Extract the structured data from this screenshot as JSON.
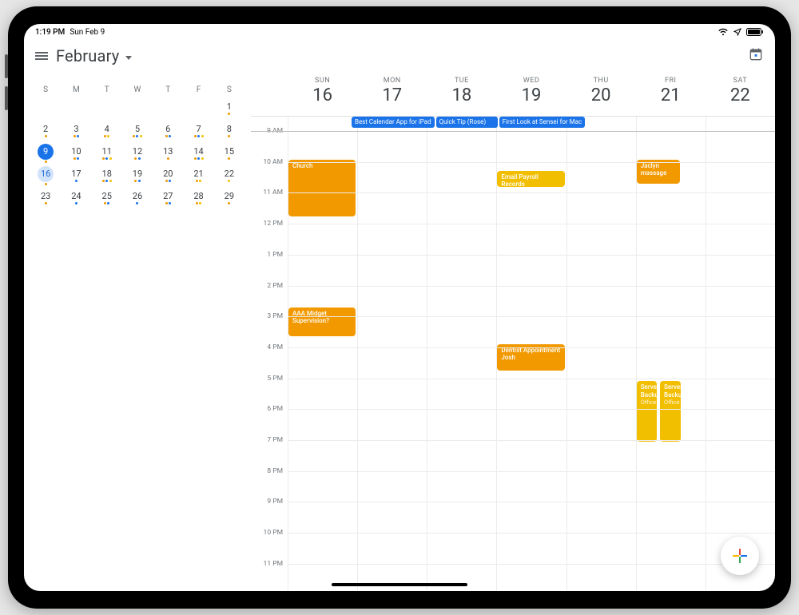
{
  "statusbar": {
    "time": "1:19 PM",
    "date": "Sun Feb 9"
  },
  "header": {
    "month": "February"
  },
  "mini": {
    "dow": [
      "S",
      "M",
      "T",
      "W",
      "T",
      "F",
      "S"
    ],
    "rows": [
      [
        {
          "n": "",
          "d": []
        },
        {
          "n": "",
          "d": []
        },
        {
          "n": "",
          "d": []
        },
        {
          "n": "",
          "d": []
        },
        {
          "n": "",
          "d": []
        },
        {
          "n": "",
          "d": []
        },
        {
          "n": "1",
          "d": [
            "o"
          ]
        }
      ],
      [
        {
          "n": "2",
          "d": [
            "o"
          ]
        },
        {
          "n": "3",
          "d": [
            "o",
            "b"
          ]
        },
        {
          "n": "4",
          "d": [
            "o",
            "y"
          ]
        },
        {
          "n": "5",
          "d": [
            "o",
            "b",
            "y"
          ]
        },
        {
          "n": "6",
          "d": [
            "o",
            "b"
          ]
        },
        {
          "n": "7",
          "d": [
            "o",
            "b",
            "y"
          ]
        },
        {
          "n": "8",
          "d": [
            "o"
          ]
        }
      ],
      [
        {
          "n": "9",
          "d": [
            "o"
          ],
          "today": true
        },
        {
          "n": "10",
          "d": [
            "o",
            "b"
          ]
        },
        {
          "n": "11",
          "d": [
            "o",
            "b",
            "y"
          ]
        },
        {
          "n": "12",
          "d": [
            "o",
            "b"
          ]
        },
        {
          "n": "13",
          "d": [
            "o"
          ]
        },
        {
          "n": "14",
          "d": [
            "o",
            "b",
            "y"
          ]
        },
        {
          "n": "15",
          "d": [
            "o"
          ]
        }
      ],
      [
        {
          "n": "16",
          "d": [
            "o"
          ],
          "sel": true
        },
        {
          "n": "17",
          "d": [
            "b"
          ]
        },
        {
          "n": "18",
          "d": [
            "o",
            "b",
            "y"
          ]
        },
        {
          "n": "19",
          "d": [
            "o",
            "b"
          ]
        },
        {
          "n": "20",
          "d": [
            "o",
            "b"
          ]
        },
        {
          "n": "21",
          "d": [
            "o",
            "y"
          ]
        },
        {
          "n": "22",
          "d": [
            "y"
          ]
        }
      ],
      [
        {
          "n": "23",
          "d": [
            "o"
          ]
        },
        {
          "n": "24",
          "d": [
            "b"
          ]
        },
        {
          "n": "25",
          "d": [
            "o",
            "b"
          ]
        },
        {
          "n": "26",
          "d": [
            "b"
          ]
        },
        {
          "n": "27",
          "d": [
            "o",
            "b"
          ]
        },
        {
          "n": "28",
          "d": [
            "o",
            "y"
          ]
        },
        {
          "n": "29",
          "d": [
            "o"
          ]
        }
      ]
    ]
  },
  "week": {
    "days": [
      {
        "dow": "SUN",
        "num": "16"
      },
      {
        "dow": "MON",
        "num": "17"
      },
      {
        "dow": "TUE",
        "num": "18"
      },
      {
        "dow": "WED",
        "num": "19"
      },
      {
        "dow": "THU",
        "num": "20"
      },
      {
        "dow": "FRI",
        "num": "21"
      },
      {
        "dow": "SAT",
        "num": "22"
      }
    ],
    "times": [
      "9 AM",
      "10 AM",
      "11 AM",
      "12 PM",
      "1 PM",
      "2 PM",
      "3 PM",
      "4 PM",
      "5 PM",
      "6 PM",
      "7 PM",
      "8 PM",
      "9 PM",
      "10 PM",
      "11 PM"
    ],
    "allday": {
      "1": {
        "title": "Best Calendar App for iPad"
      },
      "2": {
        "title": "Quick Tip (Rose)"
      },
      "3": {
        "title": "First Look at Sensei for Mac"
      }
    },
    "events": [
      {
        "col": 0,
        "title": "Church",
        "start": 0.92,
        "dur": 1.9,
        "cls": "orange",
        "left": 0,
        "w": 1
      },
      {
        "col": 0,
        "title": "AAA Midget Supervision?",
        "start": 5.7,
        "dur": 1.0,
        "cls": "orange",
        "left": 0,
        "w": 1
      },
      {
        "col": 3,
        "title": "Email Payroll Records",
        "start": 1.3,
        "dur": 0.55,
        "cls": "amber",
        "left": 0,
        "w": 1
      },
      {
        "col": 3,
        "title": "Dentist Appointment Josh",
        "start": 6.9,
        "dur": 0.9,
        "cls": "orange",
        "left": 0,
        "w": 1
      },
      {
        "col": 5,
        "title": "Jaclyn massage",
        "start": 0.92,
        "dur": 0.85,
        "cls": "orange",
        "left": 0,
        "w": 0.65
      },
      {
        "col": 5,
        "title": "Server Backup",
        "loc": "Office",
        "start": 8.1,
        "dur": 2.0,
        "cls": "amber",
        "left": 0,
        "w": 0.32
      },
      {
        "col": 5,
        "title": "Server Backup",
        "loc": "Office",
        "start": 8.1,
        "dur": 2.0,
        "cls": "amber",
        "left": 0.34,
        "w": 0.32
      }
    ]
  }
}
